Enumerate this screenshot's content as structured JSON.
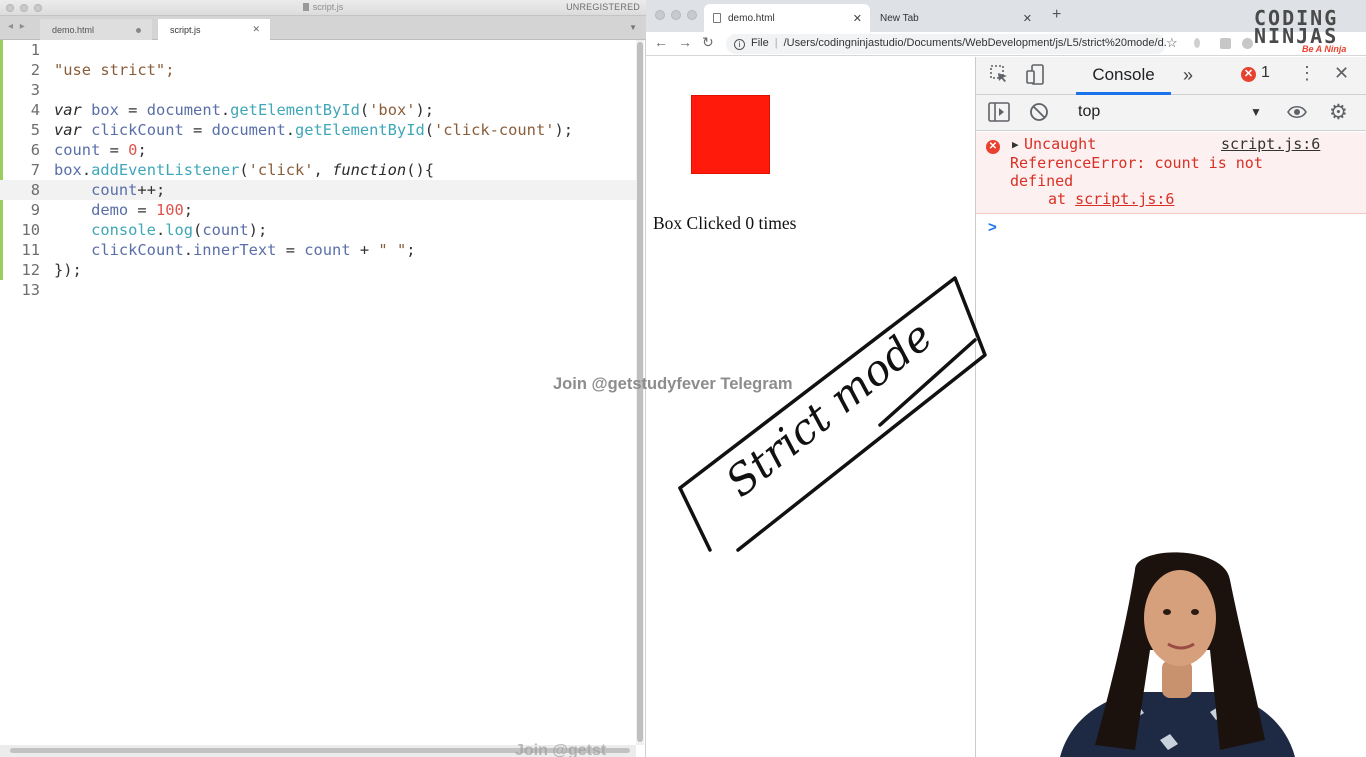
{
  "editor": {
    "title": "script.js",
    "registration": "UNREGISTERED",
    "nav_arrows": "◂ ▸",
    "tabs": [
      {
        "label": "demo.html"
      },
      {
        "label": "script.js"
      }
    ],
    "lines": [
      "1",
      "2",
      "3",
      "4",
      "5",
      "6",
      "7",
      "8",
      "9",
      "10",
      "11",
      "12",
      "13"
    ]
  },
  "browser": {
    "tabs": [
      {
        "label": "demo.html"
      },
      {
        "label": "New Tab"
      }
    ],
    "address": {
      "scheme_label": "File",
      "url": "/Users/codingninjastudio/Documents/WebDevelopment/js/L5/strict%20mode/d..."
    },
    "page": {
      "click_count_text": "Box Clicked 0 times",
      "box_color": "#ff1a0b"
    },
    "devtools": {
      "tab_label": "Console",
      "error_count": "1",
      "context": "top",
      "error": {
        "line1": "Uncaught",
        "source": "script.js:6",
        "line2": "ReferenceError: count is not",
        "line3": "defined",
        "at_prefix": "at ",
        "at_link": "script.js:6"
      },
      "prompt": ">"
    }
  },
  "overlay": {
    "logo_line1": "CODING",
    "logo_line2": "NINJAS",
    "logo_tagline": "Be A Ninja",
    "watermark": "Join @getstudyfever Telegram",
    "watermark_bottom": "Join @getst",
    "sketch_text": "Strict mode"
  },
  "colors": {
    "accent": "#1a73e8",
    "error": "#d93025",
    "box": "#ff1a0b"
  }
}
